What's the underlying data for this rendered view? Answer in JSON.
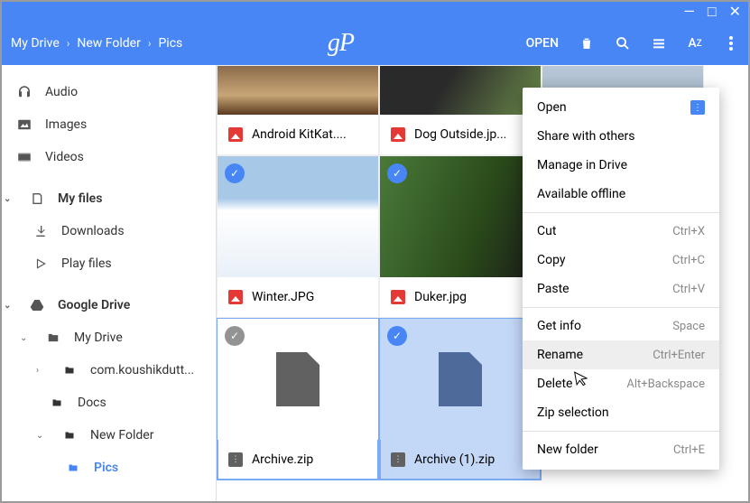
{
  "titlebar": {
    "min": "—",
    "max": "□",
    "close": "✕"
  },
  "breadcrumb": [
    "My Drive",
    "New Folder",
    "Pics"
  ],
  "logo": "gP",
  "toolbar": {
    "open": "OPEN"
  },
  "sidebar": {
    "audio": "Audio",
    "images": "Images",
    "videos": "Videos",
    "myfiles": "My files",
    "downloads": "Downloads",
    "playfiles": "Play files",
    "gdrive": "Google Drive",
    "mydrive": "My Drive",
    "com": "com.koushikdutt...",
    "docs": "Docs",
    "newfolder": "New Folder",
    "pics": "Pics"
  },
  "files": [
    {
      "name": "Android KitKat....",
      "type": "image",
      "selected": false
    },
    {
      "name": "Dog Outside.jp...",
      "type": "image",
      "selected": false
    },
    {
      "name": "",
      "type": "image-partial",
      "selected": false
    },
    {
      "name": "Winter.JPG",
      "type": "image",
      "selected": true
    },
    {
      "name": "Duker.jpg",
      "type": "image",
      "selected": true
    },
    {
      "name": "",
      "type": "image-partial2",
      "selected": false
    },
    {
      "name": "Archive.zip",
      "type": "zip",
      "selected": true
    },
    {
      "name": "Archive (1).zip",
      "type": "zip",
      "selected": true
    }
  ],
  "context_menu": [
    {
      "label": "Open",
      "key": "",
      "badge": true
    },
    {
      "label": "Share with others",
      "key": ""
    },
    {
      "label": "Manage in Drive",
      "key": ""
    },
    {
      "label": "Available offline",
      "key": ""
    },
    "hr",
    {
      "label": "Cut",
      "key": "Ctrl+X"
    },
    {
      "label": "Copy",
      "key": "Ctrl+C"
    },
    {
      "label": "Paste",
      "key": "Ctrl+V"
    },
    "hr",
    {
      "label": "Get info",
      "key": "Space"
    },
    {
      "label": "Rename",
      "key": "Ctrl+Enter",
      "hover": true
    },
    {
      "label": "Delete",
      "key": "Alt+Backspace"
    },
    {
      "label": "Zip selection",
      "key": ""
    },
    "hr",
    {
      "label": "New folder",
      "key": "Ctrl+E"
    }
  ]
}
